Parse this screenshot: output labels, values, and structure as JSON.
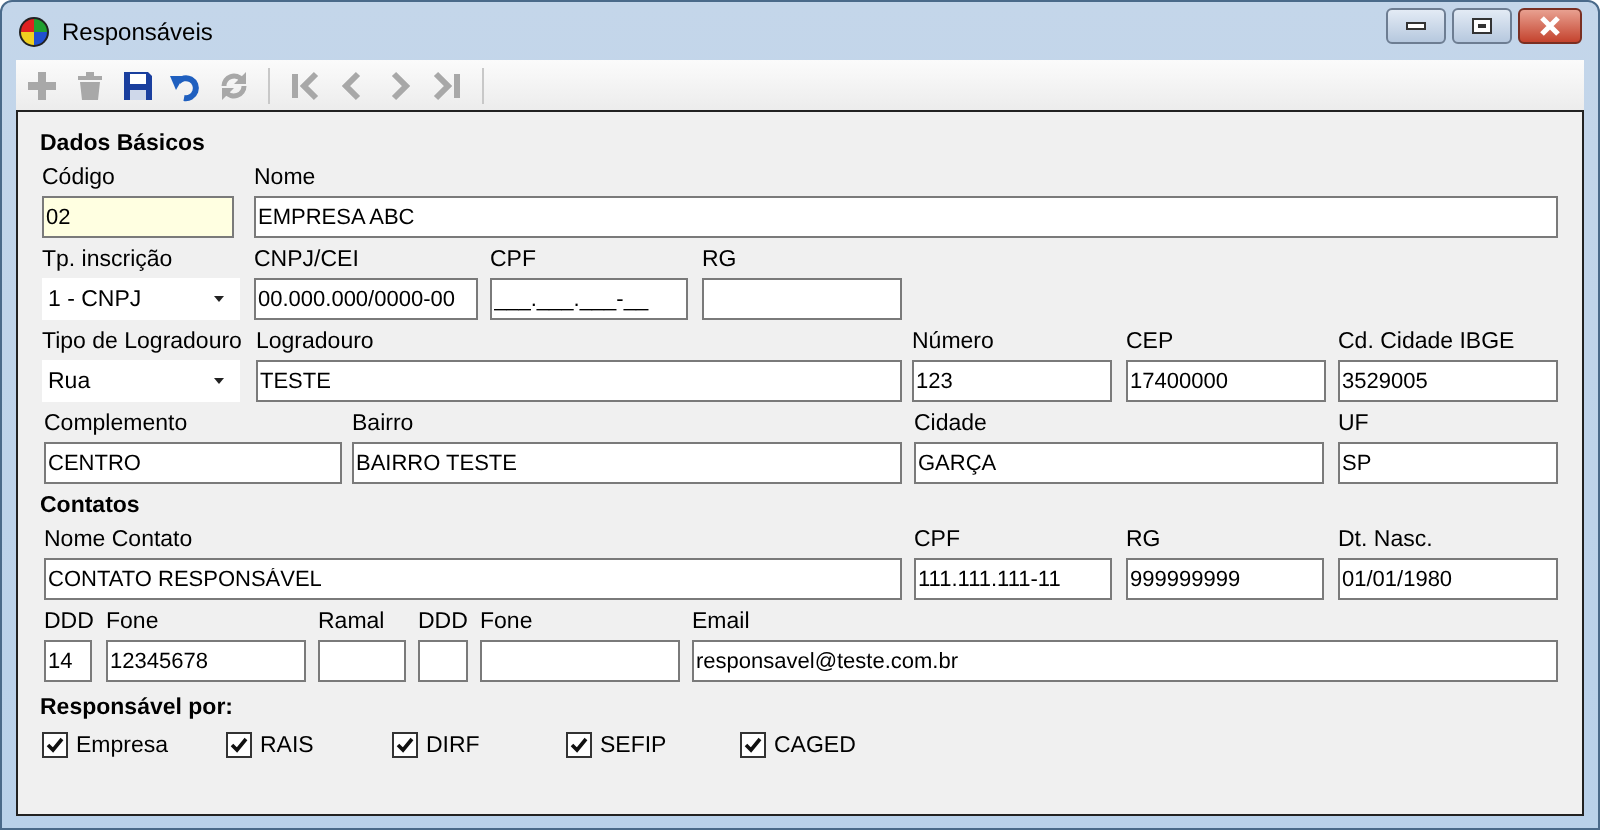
{
  "window": {
    "title": "Responsáveis"
  },
  "toolbar": [
    {
      "kind": "add",
      "disabled": true
    },
    {
      "kind": "delete",
      "disabled": true
    },
    {
      "kind": "save",
      "disabled": false
    },
    {
      "kind": "undo",
      "disabled": false
    },
    {
      "kind": "refresh",
      "disabled": true
    },
    {
      "kind": "separator"
    },
    {
      "kind": "first",
      "disabled": true
    },
    {
      "kind": "prev",
      "disabled": true
    },
    {
      "kind": "next",
      "disabled": true
    },
    {
      "kind": "last",
      "disabled": true
    },
    {
      "kind": "separator"
    }
  ],
  "sections": [
    {
      "title": "Dados Básicos",
      "fields": [
        {
          "label": "Código",
          "value": "02",
          "kind": "key"
        },
        {
          "label": "Nome",
          "value": "EMPRESA ABC",
          "kind": "text"
        },
        {
          "label": "Tp. inscrição",
          "value": "1 - CNPJ",
          "kind": "combo"
        },
        {
          "label": "CNPJ/CEI",
          "value": "00.000.000/0000-00",
          "kind": "text"
        },
        {
          "label": "CPF",
          "value": "___.___.___-__",
          "kind": "text"
        },
        {
          "label": "RG",
          "kind": "text"
        },
        {
          "label": "Tipo de Logradouro",
          "value": "Rua",
          "kind": "combo"
        },
        {
          "label": "Logradouro",
          "value": "TESTE",
          "kind": "text"
        },
        {
          "label": "Número",
          "value": "123",
          "kind": "text"
        },
        {
          "label": "CEP",
          "value": "17400000",
          "kind": "text"
        },
        {
          "label": "Cd. Cidade IBGE",
          "value": "3529005",
          "kind": "text"
        },
        {
          "label": "Complemento",
          "value": "CENTRO",
          "kind": "text"
        },
        {
          "label": "Bairro",
          "value": "BAIRRO TESTE",
          "kind": "text"
        },
        {
          "label": "Cidade",
          "value": "GARÇA",
          "kind": "text"
        },
        {
          "label": "UF",
          "value": "SP",
          "kind": "text"
        }
      ]
    },
    {
      "title": "Contatos",
      "fields": [
        {
          "label": "Nome Contato",
          "value": "CONTATO RESPONSÁVEL",
          "kind": "text"
        },
        {
          "label": "CPF",
          "value": "111.111.111-11",
          "kind": "text"
        },
        {
          "label": "RG",
          "value": "999999999",
          "kind": "text"
        },
        {
          "label": "Dt. Nasc.",
          "value": "01/01/1980",
          "kind": "text"
        },
        {
          "label": "DDD",
          "value": "14",
          "kind": "text"
        },
        {
          "label": "Fone",
          "value": "12345678",
          "kind": "text"
        },
        {
          "label": "Ramal",
          "kind": "text"
        },
        {
          "label": "DDD",
          "kind": "text"
        },
        {
          "label": "Fone",
          "kind": "text"
        },
        {
          "label": "Email",
          "value": "responsavel@teste.com.br",
          "kind": "text"
        }
      ]
    }
  ],
  "responsible": {
    "title": "Responsável por:",
    "options": [
      {
        "label": "Empresa",
        "checked": true
      },
      {
        "label": "RAIS",
        "checked": true
      },
      {
        "label": "DIRF",
        "checked": true
      },
      {
        "label": "SEFIP",
        "checked": true
      },
      {
        "label": "CAGED",
        "checked": true
      }
    ]
  }
}
